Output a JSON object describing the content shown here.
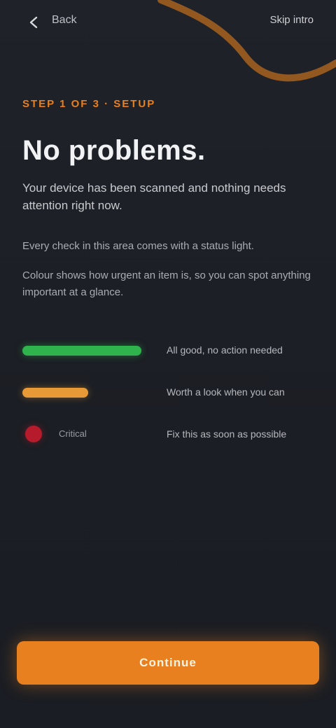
{
  "header": {
    "back_icon": "arrow-left-icon",
    "title": "Back",
    "skip_label": "Skip intro"
  },
  "intro": {
    "eyebrow": "Step 1 of 3 · Setup",
    "title": "No problems.",
    "lead": "Your device has been scanned and nothing needs attention right now.",
    "paragraph_1": "Every check in this area comes with a status light.",
    "paragraph_2": "Colour shows how urgent an item is, so you can spot anything important at a glance."
  },
  "legend": {
    "items": [
      {
        "kind": "bar",
        "color": "#2fb34d",
        "level": 1.0,
        "label": "All good, no action needed"
      },
      {
        "kind": "bar",
        "color": "#e79a36",
        "level": 0.55,
        "label": "Worth a look when you can"
      },
      {
        "kind": "dot",
        "color": "#b51b2a",
        "inline_label": "Critical",
        "label": "Fix this as soon as possible"
      }
    ]
  },
  "cta": {
    "label": "Continue"
  },
  "colors": {
    "accent": "#e8801f",
    "background": "#1b1e24"
  }
}
